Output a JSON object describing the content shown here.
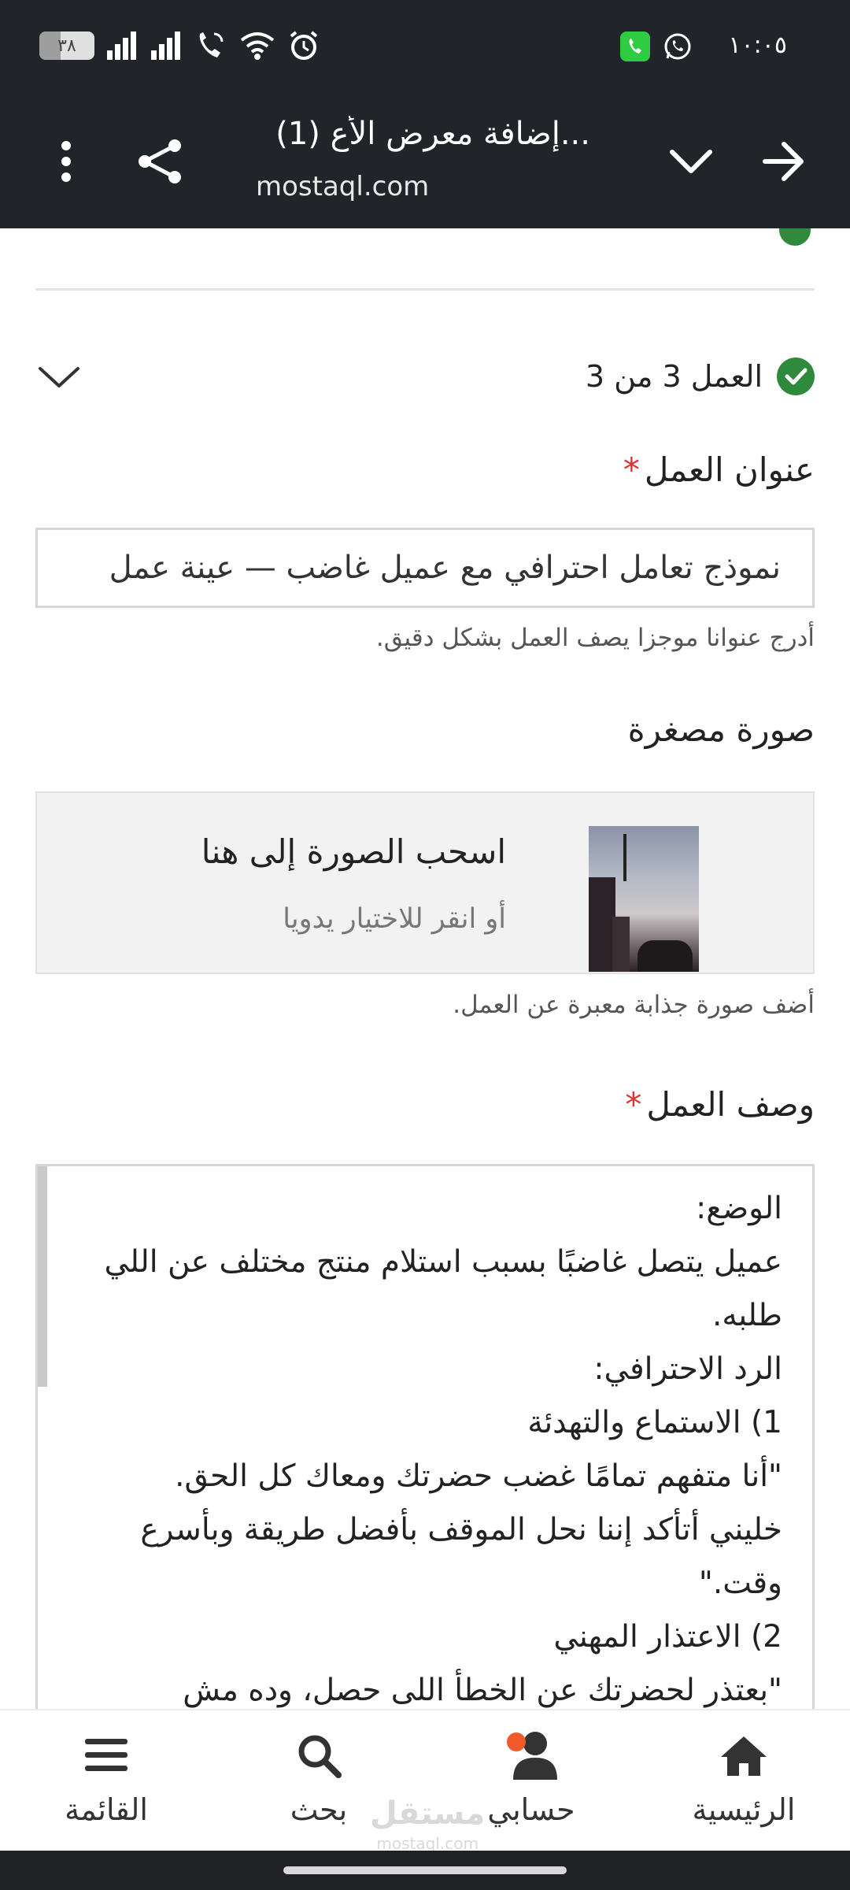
{
  "status_bar": {
    "time": "١٠:٠٥",
    "battery_level": "٣٨",
    "battery_fraction": 0.38
  },
  "browser": {
    "tab_title": "(1) إضافة معرض الأع...",
    "url": "mostaql.com"
  },
  "form": {
    "work_counter": "العمل 3 من 3",
    "title_field": {
      "label": "عنوان العمل",
      "required_mark": "*",
      "value": "نموذج تعامل احترافي مع عميل غاضب — عينة عمل",
      "hint": "أدرج عنوانا موجزا يصف العمل بشكل دقيق."
    },
    "thumbnail": {
      "label": "صورة مصغرة",
      "drop_title": "اسحب الصورة إلى هنا",
      "drop_subtitle": "أو انقر للاختيار يدويا",
      "hint": "أضف صورة جذابة معبرة عن العمل."
    },
    "description": {
      "label": "وصف العمل",
      "required_mark": "*",
      "lines": [
        "الوضع:",
        "عميل يتصل غاضبًا بسبب استلام منتج مختلف عن اللي",
        "طلبه.",
        "الرد الاحترافي:",
        "1) الاستماع والتهدئة",
        "\"أنا متفهم تمامًا غضب حضرتك ومعاك كل الحق.",
        "خليني أتأكد إننا نحل الموقف بأفضل طريقة وبأسرع",
        "وقت.\"",
        "2) الاعتذار المهني",
        "\"بعتذر لحضرتك عن الخطأ اللى حصل، وده مش"
      ]
    }
  },
  "bottom_nav": {
    "home": "الرئيسية",
    "account": "حسابي",
    "search": "بحث",
    "menu": "القائمة",
    "watermark": "مستقل",
    "watermark_sub": "mostaql.com"
  },
  "colors": {
    "top_bar": "#212529",
    "success_green": "#2f8a3e",
    "required_red": "#e03030",
    "notification_dot": "#f05a28"
  }
}
